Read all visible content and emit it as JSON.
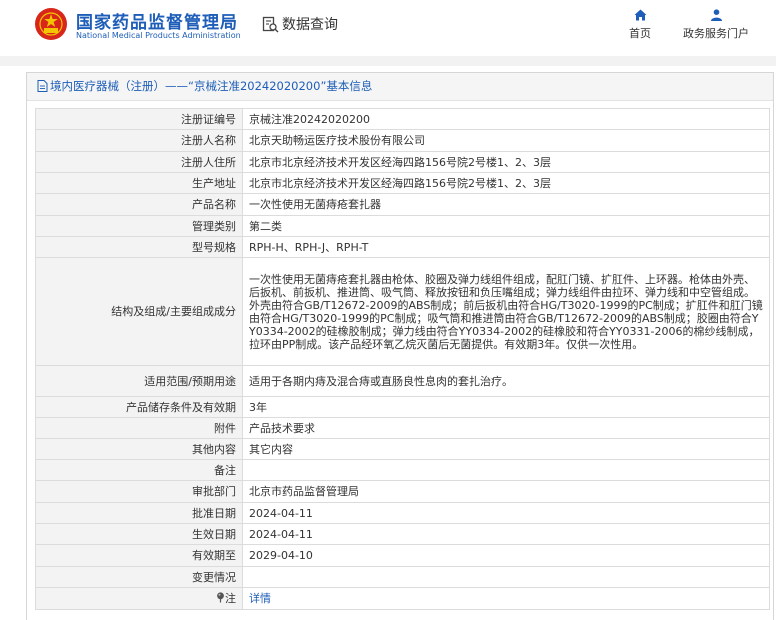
{
  "header": {
    "logo_cn": "国家药品监督管理局",
    "logo_en": "National Medical Products Administration",
    "search_label": "数据查询",
    "nav_home": "首页",
    "nav_portal": "政务服务门户",
    "brand_color": "#1e5eb8",
    "emblem_color": "#d8261b"
  },
  "panel": {
    "title": "境内医疗器械（注册）——“京械注准20242020200”基本信息"
  },
  "fields": [
    {
      "label": "注册证编号",
      "value": "京械注准20242020200"
    },
    {
      "label": "注册人名称",
      "value": "北京天助畅运医疗技术股份有限公司"
    },
    {
      "label": "注册人住所",
      "value": "北京市北京经济技术开发区经海四路156号院2号楼1、2、3层"
    },
    {
      "label": "生产地址",
      "value": "北京市北京经济技术开发区经海四路156号院2号楼1、2、3层"
    },
    {
      "label": "产品名称",
      "value": "一次性使用无菌痔疮套扎器"
    },
    {
      "label": "管理类别",
      "value": "第二类"
    },
    {
      "label": "型号规格",
      "value": "RPH-H、RPH-J、RPH-T"
    },
    {
      "label": "结构及组成/主要组成成分",
      "value": "一次性使用无菌痔疮套扎器由枪体、胶圈及弹力线组件组成，配肛门镜、扩肛件、上环器。枪体由外壳、后扳机、前扳机、推进筒、吸气筒、释放按钮和负压嘴组成；弹力线组件由拉环、弹力线和中空管组成。外壳由符合GB/T12672-2009的ABS制成；前后扳机由符合HG/T3020-1999的PC制成；扩肛件和肛门镜由符合HG/T3020-1999的PC制成；吸气筒和推进筒由符合GB/T12672-2009的ABS制成；胶圈由符合YY0334-2002的硅橡胶制成；弹力线由符合YY0334-2002的硅橡胶和符合YY0331-2006的棉纱线制成，拉环由PP制成。该产品经环氧乙烷灭菌后无菌提供。有效期3年。仅供一次性用。"
    },
    {
      "label": "适用范围/预期用途",
      "value": "适用于各期内痔及混合痔或直肠良性息肉的套扎治疗。"
    },
    {
      "label": "产品储存条件及有效期",
      "value": "3年"
    },
    {
      "label": "附件",
      "value": "产品技术要求"
    },
    {
      "label": "其他内容",
      "value": "其它内容"
    },
    {
      "label": "备注",
      "value": ""
    },
    {
      "label": "审批部门",
      "value": "北京市药品监督管理局"
    },
    {
      "label": "批准日期",
      "value": "2024-04-11"
    },
    {
      "label": "生效日期",
      "value": "2024-04-11"
    },
    {
      "label": "有效期至",
      "value": "2029-04-10"
    },
    {
      "label": "变更情况",
      "value": ""
    },
    {
      "label": "注",
      "value": "详情",
      "icon": "pin-icon"
    }
  ]
}
